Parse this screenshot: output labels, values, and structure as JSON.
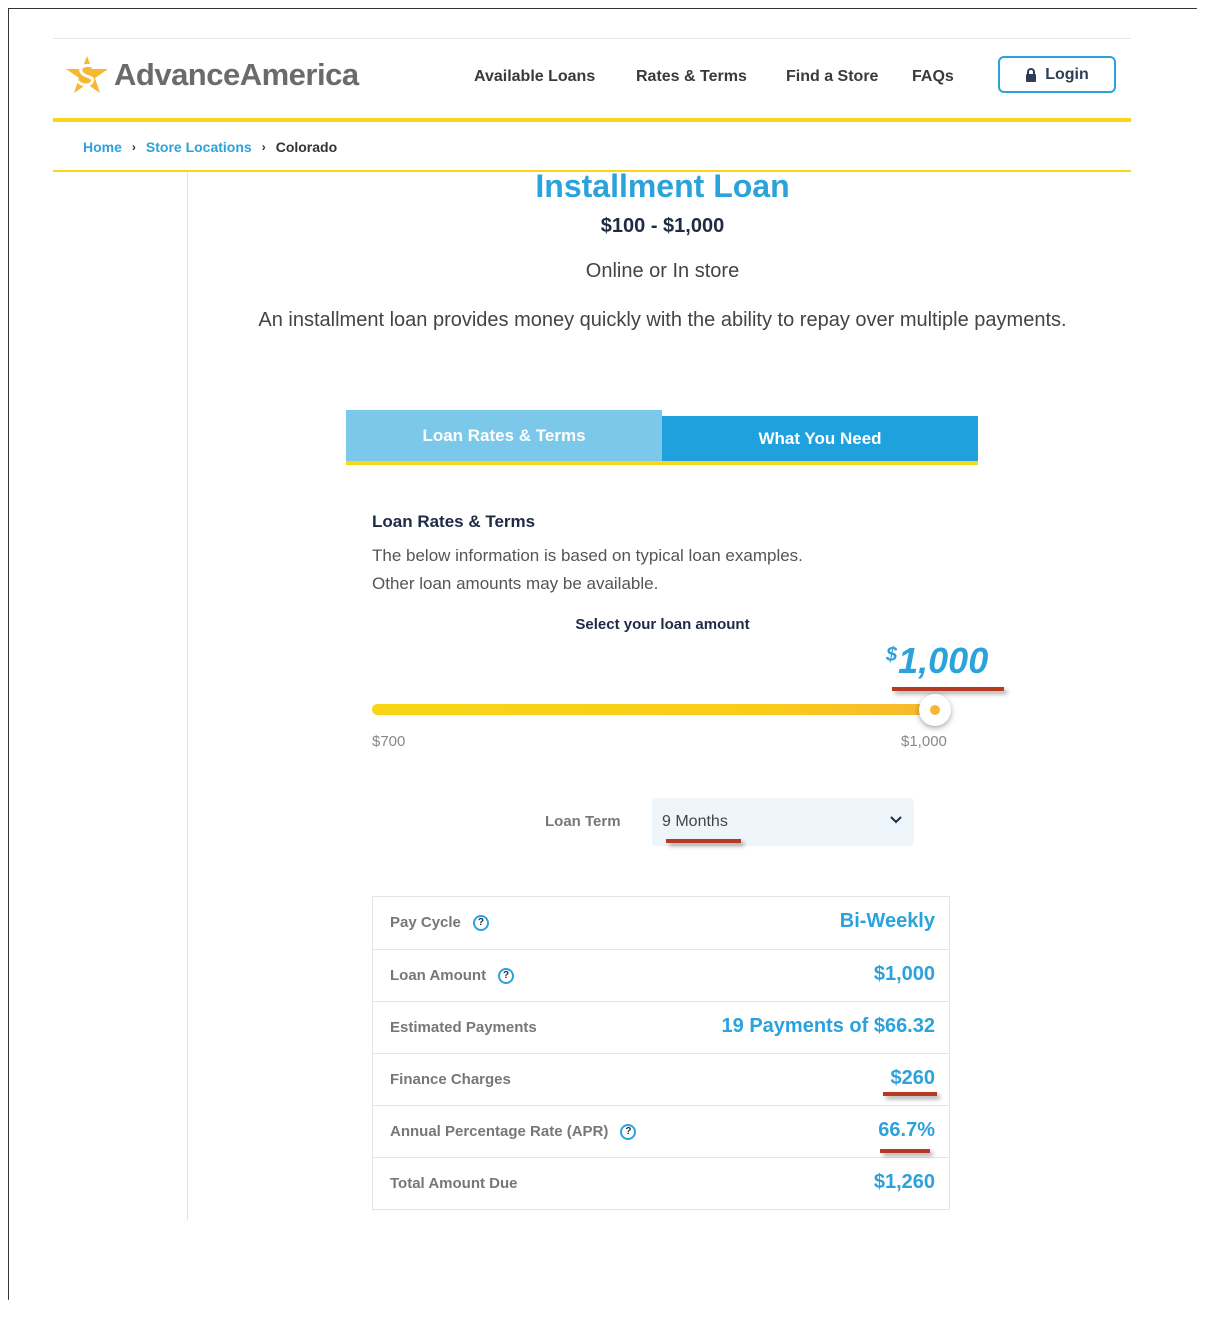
{
  "header": {
    "logo_text": "AdvanceAmerica",
    "nav": [
      "Available Loans",
      "Rates & Terms",
      "Find a Store",
      "FAQs"
    ],
    "login_label": "Login"
  },
  "breadcrumb": {
    "home": "Home",
    "store_locations": "Store Locations",
    "current": "Colorado"
  },
  "hero": {
    "title": "Installment Loan",
    "range": "$100 - $1,000",
    "channel": "Online or In store",
    "description": "An installment loan provides money quickly with the ability to repay over multiple payments."
  },
  "tabs": [
    "Loan Rates & Terms",
    "What You Need"
  ],
  "panel": {
    "title": "Loan Rates & Terms",
    "line1": "The below information is based on typical loan examples.",
    "line2": "Other loan amounts may be available.",
    "select_label": "Select your loan amount",
    "amount_symbol": "$",
    "amount_value": "1,000",
    "slider": {
      "min_label": "$700",
      "max_label": "$1,000",
      "position_fraction": 1.0
    },
    "term_label": "Loan Term",
    "term_value": "9 Months"
  },
  "table": [
    {
      "label": "Pay Cycle",
      "value": "Bi-Weekly"
    },
    {
      "label": "Loan Amount",
      "value": "$1,000"
    },
    {
      "label": "Estimated Payments",
      "value": "19 Payments of $66.32"
    },
    {
      "label": "Finance Charges",
      "value": "$260"
    },
    {
      "label": "Annual Percentage Rate (APR)",
      "value": "66.7%"
    },
    {
      "label": "Total Amount Due",
      "value": "$1,260"
    }
  ],
  "icons": {
    "help": "?"
  },
  "colors": {
    "brand_blue": "#2ba2db",
    "brand_yellow": "#f9d51c",
    "annotation_red": "#b53a22"
  }
}
